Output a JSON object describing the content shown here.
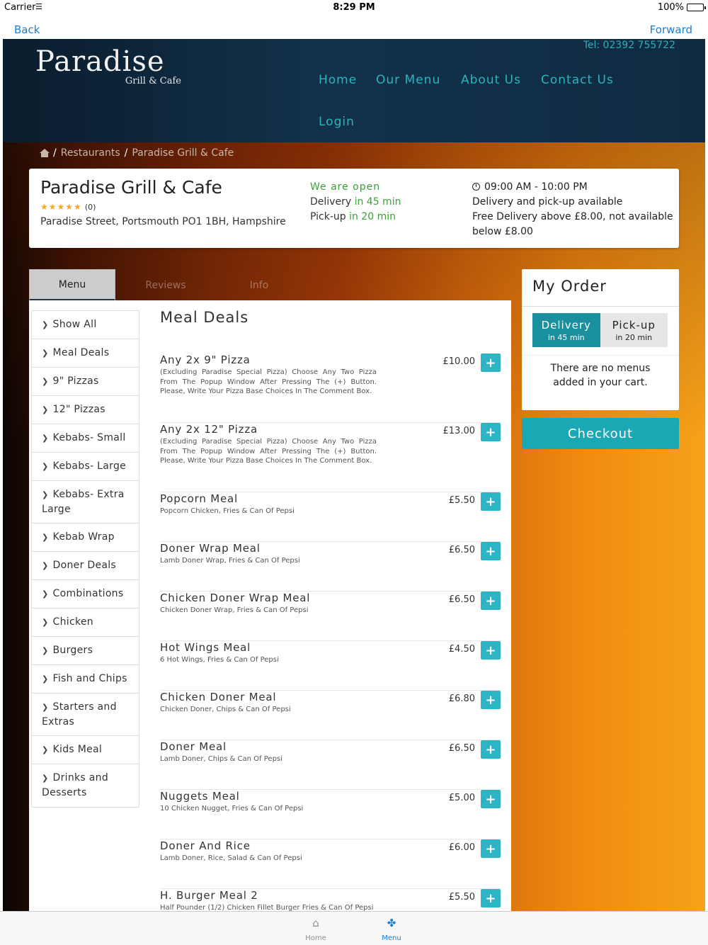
{
  "status_bar": {
    "carrier": "Carrier",
    "time": "8:29 PM",
    "battery": "100%"
  },
  "nav": {
    "back": "Back",
    "forward": "Forward"
  },
  "header": {
    "logo_main": "Paradise",
    "logo_sub": "Grill & Cafe",
    "tel": "Tel: 02392 755722",
    "menu": {
      "home": "Home",
      "our_menu": "Our Menu",
      "about_us": "About Us",
      "contact_us": "Contact Us",
      "login": "Login"
    }
  },
  "breadcrumb": {
    "restaurants": "Restaurants",
    "current": "Paradise Grill & Cafe",
    "sep": "/"
  },
  "restaurant": {
    "name": "Paradise Grill & Cafe",
    "rating_count": "(0)",
    "stars": 5,
    "address": "Paradise Street, Portsmouth PO1 1BH, Hampshire",
    "open_status": "We are open",
    "delivery_label": "Delivery",
    "delivery_time": "in 45 min",
    "pickup_label": "Pick-up",
    "pickup_time": "in 20 min",
    "hours": "09:00 AM - 10:00 PM",
    "delivery_note": "Delivery and pick-up available",
    "free_delivery": "Free Delivery above £8.00, not available below £8.00"
  },
  "tabs": {
    "menu": "Menu",
    "reviews": "Reviews",
    "info": "Info"
  },
  "categories": [
    "Show All",
    "Meal Deals",
    "9\" Pizzas",
    "12\" Pizzas",
    "Kebabs- Small",
    "Kebabs- Large",
    "Kebabs- Extra Large",
    "Kebab Wrap",
    "Doner Deals",
    "Combinations",
    "Chicken",
    "Burgers",
    "Fish and Chips",
    "Starters and Extras",
    "Kids Meal",
    "Drinks and Desserts"
  ],
  "meals_title": "Meal Deals",
  "meals": [
    {
      "name": "Any 2x 9\" Pizza",
      "desc": "(Excluding Paradise Special Pizza) Choose Any Two Pizza From The Popup Window After Pressing The (+) Button. Please, Write Your Pizza Base Choices In The Comment Box.",
      "price": "£10.00"
    },
    {
      "name": "Any 2x 12\" Pizza",
      "desc": "(Excluding Paradise Special Pizza) Choose Any Two Pizza From The Popup Window After Pressing The (+) Button. Please, Write Your Pizza Base Choices In The Comment Box.",
      "price": "£13.00"
    },
    {
      "name": "Popcorn Meal",
      "desc": "Popcorn Chicken, Fries & Can Of Pepsi",
      "price": "£5.50"
    },
    {
      "name": "Doner Wrap Meal",
      "desc": "Lamb Doner Wrap, Fries & Can Of Pepsi",
      "price": "£6.50"
    },
    {
      "name": "Chicken Doner Wrap Meal",
      "desc": "Chicken Doner Wrap, Fries & Can Of Pepsi",
      "price": "£6.50"
    },
    {
      "name": "Hot Wings Meal",
      "desc": "6 Hot Wings, Fries & Can Of Pepsi",
      "price": "£4.50"
    },
    {
      "name": "Chicken Doner Meal",
      "desc": "Chicken Doner, Chips & Can Of Pepsi",
      "price": "£6.80"
    },
    {
      "name": "Doner Meal",
      "desc": "Lamb Doner, Chips & Can Of Pepsi",
      "price": "£6.50"
    },
    {
      "name": "Nuggets Meal",
      "desc": "10 Chicken Nugget, Fries & Can Of Pepsi",
      "price": "£5.00"
    },
    {
      "name": "Doner And Rice",
      "desc": "Lamb Doner, Rice, Salad & Can Of Pepsi",
      "price": "£6.00"
    },
    {
      "name": "H. Burger Meal 2",
      "desc": "Half Pounder (1/2) Chicken Fillet Burger Fries & Can Of Pepsi",
      "price": "£5.50"
    }
  ],
  "add_label": "+",
  "order": {
    "title": "My Order",
    "delivery": "Delivery",
    "delivery_time": "in 45 min",
    "pickup": "Pick-up",
    "pickup_time": "in 20 min",
    "empty": "There are no menus added in your cart.",
    "checkout": "Checkout"
  },
  "tabbar": {
    "home": "Home",
    "menu": "Menu",
    "home_icon": "home-icon",
    "menu_icon": "fork-knife-icon"
  },
  "colors": {
    "accent": "#2eb5c4",
    "open_green": "#3aa335",
    "link_blue": "#1a7fd6",
    "header_teal": "#2ab4bd"
  }
}
